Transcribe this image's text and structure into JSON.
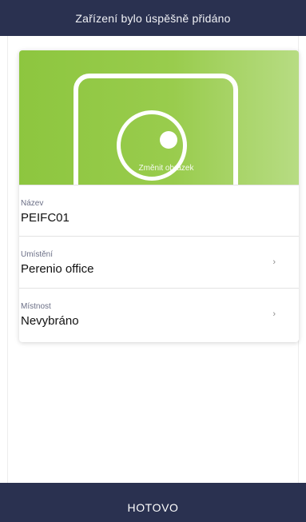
{
  "header": {
    "title": "Zařízení bylo úspěšně přidáno"
  },
  "device_card": {
    "change_image_label": "Změnit obrázek",
    "image_colors": [
      "#8dc63f",
      "#b7dc83"
    ],
    "fields": [
      {
        "label": "Název",
        "value": "PEIFC01",
        "has_chevron": false
      },
      {
        "label": "Umístění",
        "value": "Perenio office",
        "has_chevron": true,
        "chevron": "›"
      },
      {
        "label": "Místnost",
        "value": "Nevybráno",
        "has_chevron": true,
        "chevron": "›"
      }
    ]
  },
  "footer": {
    "done_label": "HOTOVO"
  },
  "colors": {
    "bar": "#2a3150",
    "accent_green": "#8dc63f"
  }
}
